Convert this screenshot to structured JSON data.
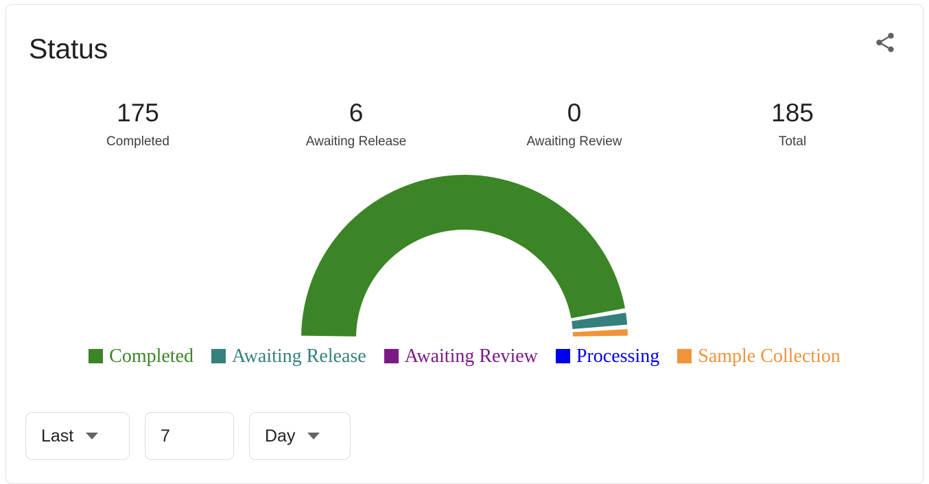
{
  "card": {
    "title": "Status",
    "share_icon": "share-icon",
    "border_color": "#e3e3e4",
    "background": "#ffffff"
  },
  "stats": [
    {
      "value": "175",
      "label": "Completed"
    },
    {
      "value": "6",
      "label": "Awaiting Release"
    },
    {
      "value": "0",
      "label": "Awaiting Review"
    },
    {
      "value": "185",
      "label": "Total"
    }
  ],
  "legend": [
    {
      "label": "Completed",
      "color": "#3c8527"
    },
    {
      "label": "Awaiting Release",
      "color": "#35807d"
    },
    {
      "label": "Awaiting Review",
      "color": "#7b1a86"
    },
    {
      "label": "Processing",
      "color": "#0000ee"
    },
    {
      "label": "Sample Collection",
      "color": "#f0933b"
    }
  ],
  "controls": {
    "range": {
      "label": "Last",
      "icon": "chevron-down-icon"
    },
    "count": {
      "value": "7",
      "placeholder": "7"
    },
    "unit": {
      "label": "Day",
      "icon": "chevron-down-icon"
    }
  },
  "chart_data": {
    "type": "pie",
    "variant": "half-donut-gauge",
    "title": "Status",
    "total": 185,
    "total_label": "Total",
    "start_angle": 180,
    "end_angle": 360,
    "inner_radius": 158,
    "outer_radius": 238,
    "pad_angle_deg": 1.6,
    "legend_position": "bottom",
    "grid": false,
    "categories": [
      "Completed",
      "Awaiting Release",
      "Awaiting Review",
      "Processing",
      "Sample Collection"
    ],
    "values": [
      175,
      6,
      0,
      0,
      4
    ],
    "colors": [
      "#3c8527",
      "#35807d",
      "#7b1a86",
      "#0000ee",
      "#f0933b"
    ],
    "series": [
      {
        "name": "Status",
        "slices": [
          {
            "label": "Completed",
            "value": 175,
            "percent": 94.6,
            "color": "#3c8527",
            "start_deg": 180.0,
            "end_deg": 350.3
          },
          {
            "label": "Awaiting Release",
            "value": 6,
            "percent": 3.2,
            "color": "#35807d",
            "start_deg": 350.3,
            "end_deg": 356.1
          },
          {
            "label": "Awaiting Review",
            "value": 0,
            "percent": 0.0,
            "color": "#7b1a86",
            "start_deg": 356.1,
            "end_deg": 356.1
          },
          {
            "label": "Processing",
            "value": 0,
            "percent": 0.0,
            "color": "#0000ee",
            "start_deg": 356.1,
            "end_deg": 356.1
          },
          {
            "label": "Sample Collection",
            "value": 4,
            "percent": 2.2,
            "color": "#f0933b",
            "start_deg": 356.1,
            "end_deg": 360.0
          }
        ]
      }
    ]
  }
}
